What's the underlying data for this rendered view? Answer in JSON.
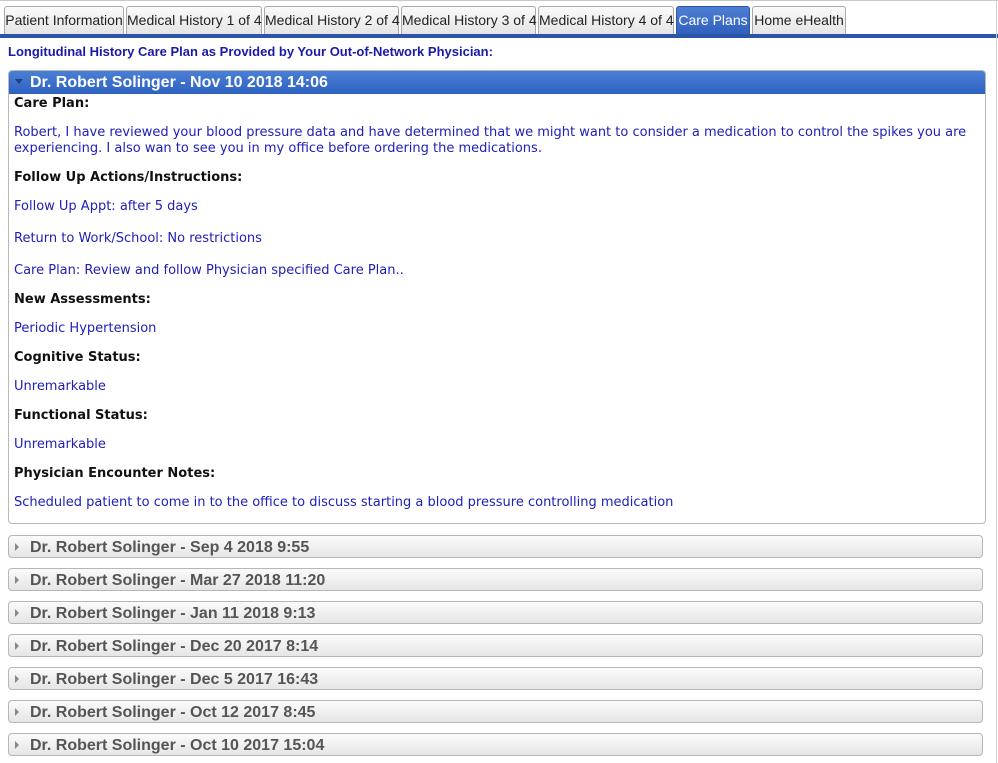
{
  "tabs": [
    {
      "label": "Patient Information",
      "active": false
    },
    {
      "label": "Medical History 1 of 4",
      "active": false
    },
    {
      "label": "Medical History 2 of 4",
      "active": false
    },
    {
      "label": "Medical History 3 of 4",
      "active": false
    },
    {
      "label": "Medical History 4 of 4",
      "active": false
    },
    {
      "label": "Care Plans",
      "active": true
    },
    {
      "label": "Home eHealth",
      "active": false
    }
  ],
  "intro": "Longitudinal History Care Plan as Provided by Your Out-of-Network Physician:",
  "open_entry": {
    "header": "Dr. Robert Solinger - Nov 10 2018 14:06",
    "care_plan_label": "Care Plan:",
    "care_plan_text": "Robert, I have reviewed your blood pressure data and have determined that we might want to consider a medication to control the spikes you are experiencing. I also wan to see you in my office before ordering the medications.",
    "follow_up_label": "Follow Up Actions/Instructions:",
    "follow_up_items": [
      "Follow Up Appt: after 5 days",
      "Return to Work/School: No restrictions",
      "Care Plan: Review and follow Physician specified Care Plan.."
    ],
    "assessments_label": "New Assessments:",
    "assessments_text": "Periodic Hypertension",
    "cognitive_label": "Cognitive Status:",
    "cognitive_text": "Unremarkable",
    "functional_label": "Functional Status:",
    "functional_text": "Unremarkable",
    "notes_label": "Physician Encounter Notes:",
    "notes_text": "Scheduled patient to come in to the office to discuss starting a blood pressure controlling medication"
  },
  "collapsed_entries": [
    "Dr. Robert Solinger - Sep 4 2018 9:55",
    "Dr. Robert Solinger - Mar 27 2018 11:20",
    "Dr. Robert Solinger - Jan 11 2018 9:13",
    "Dr. Robert Solinger - Dec 20 2017 8:14",
    "Dr. Robert Solinger - Dec 5 2017 16:43",
    "Dr. Robert Solinger - Oct 12 2017 8:45",
    "Dr. Robert Solinger - Oct 10 2017 15:04"
  ],
  "colors": {
    "active_tab": "#3a6cc8",
    "header_text_blue": "#1a1aa6",
    "value_text": "#2020b8"
  }
}
